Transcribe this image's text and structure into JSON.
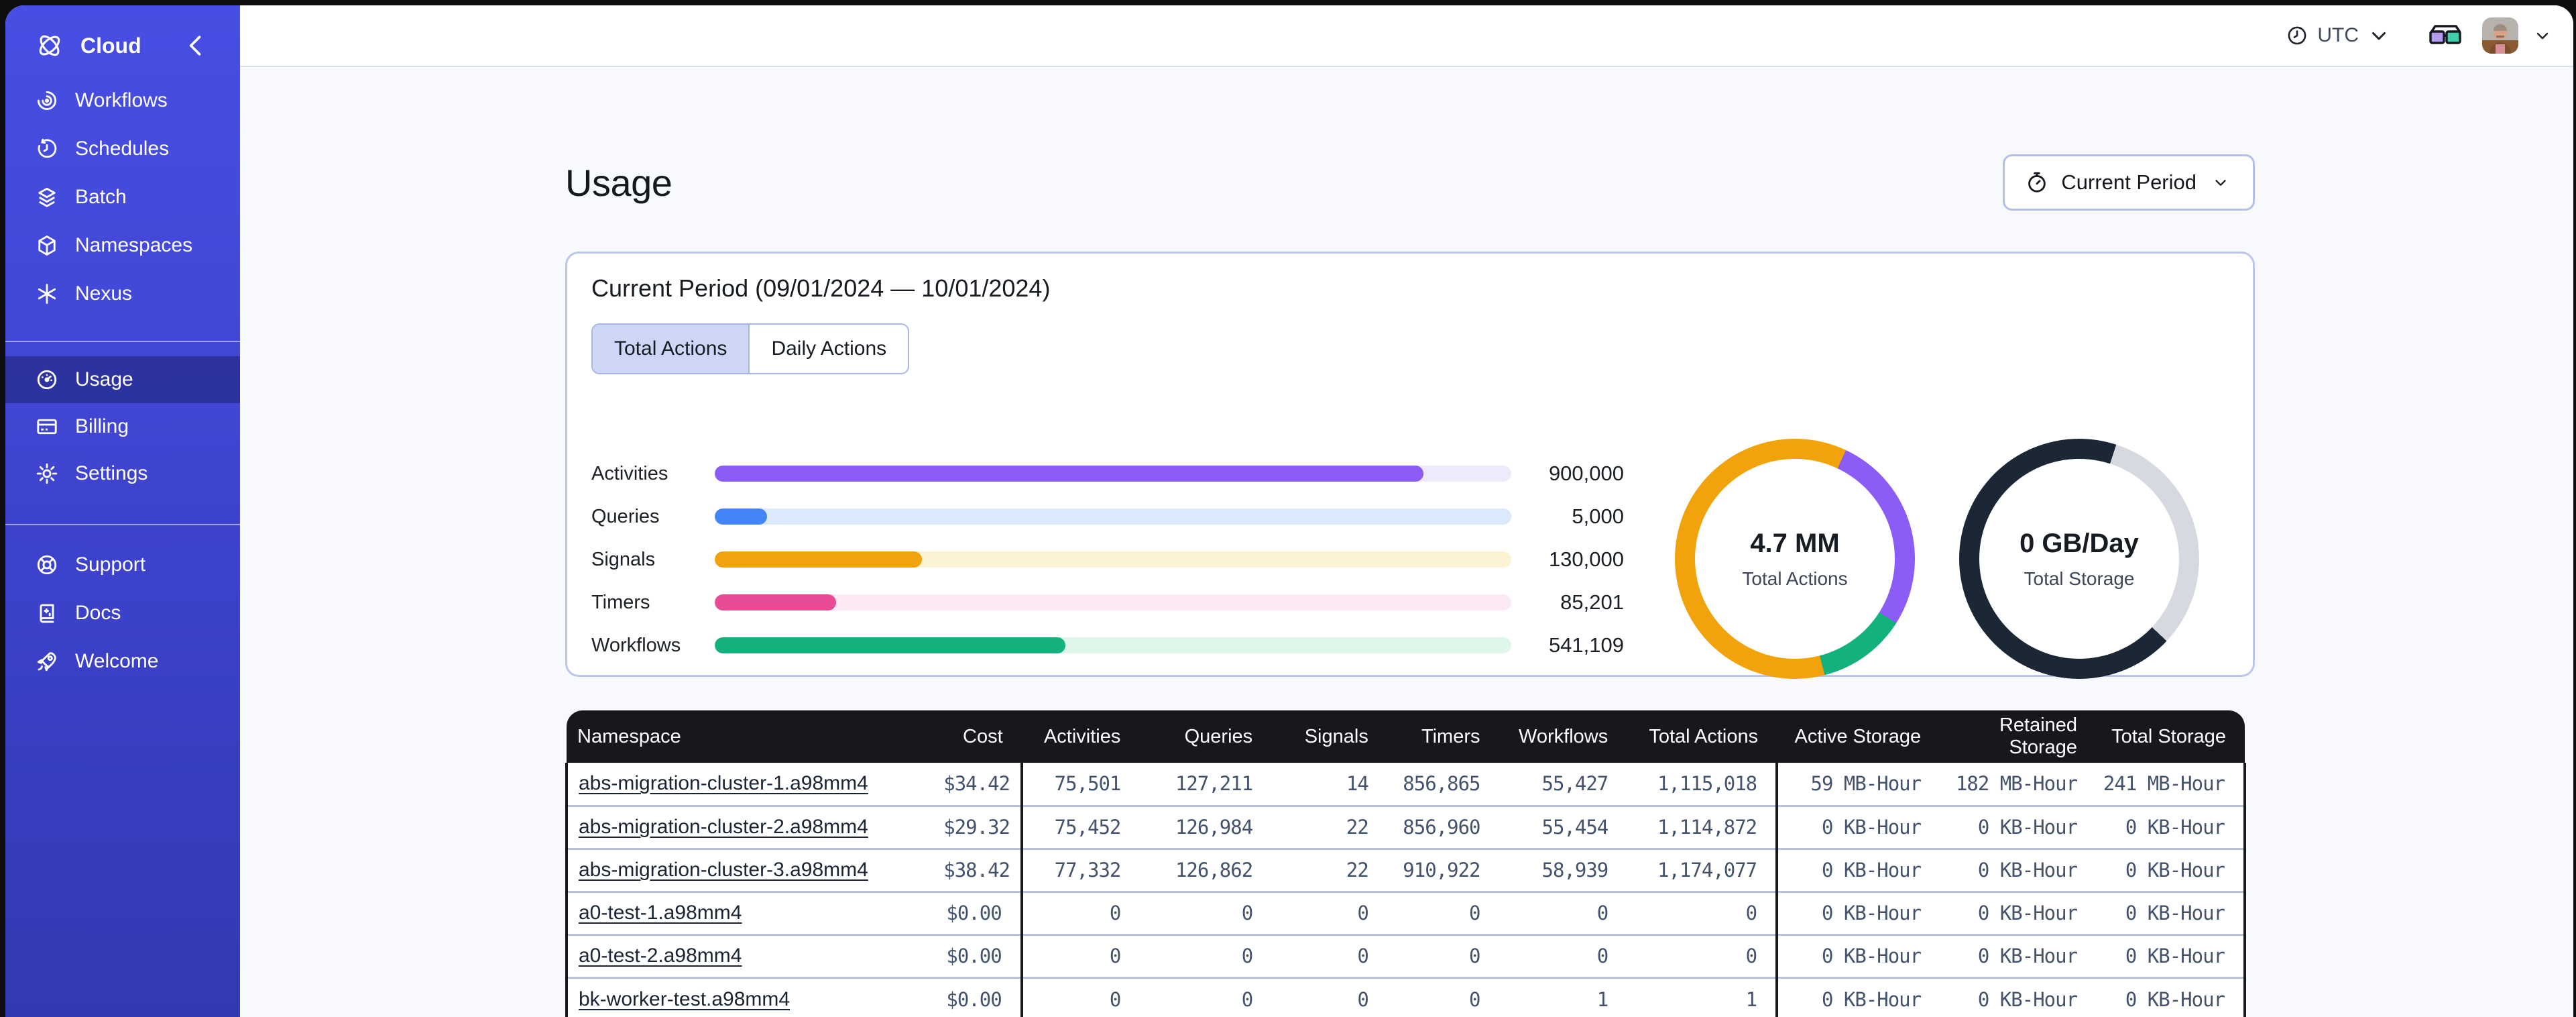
{
  "colors": {
    "sidebar_top": "#484ee3",
    "sidebar_bottom": "#3339b0",
    "accent_indigo": "#444ce7",
    "table_header_bg": "#17171e",
    "card_border": "#bcc6ec",
    "main_bg": "#f7f9fc",
    "row_separator": "#b9c3da",
    "cell_text": "#44536b"
  },
  "icons": [
    "temporal-logo-icon",
    "collapse-chevron-icon",
    "workflows-icon",
    "schedules-icon",
    "batch-icon",
    "namespaces-icon",
    "nexus-icon",
    "usage-icon",
    "billing-icon",
    "settings-icon",
    "support-icon",
    "docs-icon",
    "welcome-icon",
    "clock-icon",
    "chevron-down-icon",
    "glasses-icon",
    "stopwatch-icon"
  ],
  "sidebar": {
    "brand": {
      "label": "Cloud"
    },
    "nav_primary": [
      {
        "icon": "workflows-icon",
        "label": "Workflows"
      },
      {
        "icon": "schedules-icon",
        "label": "Schedules"
      },
      {
        "icon": "batch-icon",
        "label": "Batch"
      },
      {
        "icon": "namespaces-icon",
        "label": "Namespaces"
      },
      {
        "icon": "nexus-icon",
        "label": "Nexus"
      }
    ],
    "nav_account": [
      {
        "icon": "usage-icon",
        "label": "Usage",
        "active": true
      },
      {
        "icon": "billing-icon",
        "label": "Billing",
        "active": false
      },
      {
        "icon": "settings-icon",
        "label": "Settings",
        "active": false
      }
    ],
    "nav_footer": [
      {
        "icon": "support-icon",
        "label": "Support"
      },
      {
        "icon": "docs-icon",
        "label": "Docs"
      },
      {
        "icon": "welcome-icon",
        "label": "Welcome"
      }
    ]
  },
  "header": {
    "timezone_label": "UTC"
  },
  "page": {
    "title": "Usage",
    "period_button_label": "Current Period"
  },
  "usage_card": {
    "title": "Current Period (09/01/2024 — 10/01/2024)",
    "tabs": [
      {
        "label": "Total Actions",
        "active": true
      },
      {
        "label": "Daily Actions",
        "active": false
      }
    ],
    "chart_data": [
      {
        "type": "bar",
        "title": "Actions by type",
        "categories": [
          "Activities",
          "Queries",
          "Signals",
          "Timers",
          "Workflows"
        ],
        "values": [
          900000,
          5000,
          130000,
          85201,
          541109
        ],
        "value_labels": [
          "900,000",
          "5,000",
          "130,000",
          "85,201",
          "541,109"
        ],
        "fill_pct": [
          89,
          6.6,
          26,
          15.2,
          44
        ],
        "colors": [
          "#8b5cf6",
          "#4285f4",
          "#f2a20d",
          "#e84b93",
          "#13b27d"
        ],
        "track_colors": [
          "#eeeafb",
          "#dce8fb",
          "#fcf3d3",
          "#fce9f6",
          "#dff7eb"
        ]
      },
      {
        "type": "donut",
        "center_value": "4.7 MM",
        "center_label": "Total Actions",
        "conic_stops": [
          [
            "#f2a30b",
            0,
            7
          ],
          [
            "#8b5cf6",
            7,
            34
          ],
          [
            "#13b27d",
            34,
            46
          ],
          [
            "#f2a30b",
            46,
            100
          ]
        ]
      },
      {
        "type": "donut",
        "center_value": "0 GB/Day",
        "center_label": "Total Storage",
        "conic_stops": [
          [
            "#1c2736",
            0,
            5
          ],
          [
            "#d6d9df",
            5,
            37
          ],
          [
            "#1c2736",
            37,
            100
          ]
        ]
      }
    ]
  },
  "table": {
    "headers": [
      "Namespace",
      "Cost",
      "Activities",
      "Queries",
      "Signals",
      "Timers",
      "Workflows",
      "Total Actions",
      "Active Storage",
      "Retained Storage",
      "Total Storage"
    ],
    "rows": [
      [
        "abs-migration-cluster-1.a98mm4",
        "$34.42",
        "75,501",
        "127,211",
        "14",
        "856,865",
        "55,427",
        "1,115,018",
        "59 MB-Hour",
        "182 MB-Hour",
        "241 MB-Hour"
      ],
      [
        "abs-migration-cluster-2.a98mm4",
        "$29.32",
        "75,452",
        "126,984",
        "22",
        "856,960",
        "55,454",
        "1,114,872",
        "0 KB-Hour",
        "0 KB-Hour",
        "0 KB-Hour"
      ],
      [
        "abs-migration-cluster-3.a98mm4",
        "$38.42",
        "77,332",
        "126,862",
        "22",
        "910,922",
        "58,939",
        "1,174,077",
        "0 KB-Hour",
        "0 KB-Hour",
        "0 KB-Hour"
      ],
      [
        "a0-test-1.a98mm4",
        "$0.00",
        "0",
        "0",
        "0",
        "0",
        "0",
        "0",
        "0 KB-Hour",
        "0 KB-Hour",
        "0 KB-Hour"
      ],
      [
        "a0-test-2.a98mm4",
        "$0.00",
        "0",
        "0",
        "0",
        "0",
        "0",
        "0",
        "0 KB-Hour",
        "0 KB-Hour",
        "0 KB-Hour"
      ],
      [
        "bk-worker-test.a98mm4",
        "$0.00",
        "0",
        "0",
        "0",
        "0",
        "1",
        "1",
        "0 KB-Hour",
        "0 KB-Hour",
        "0 KB-Hour"
      ]
    ]
  }
}
